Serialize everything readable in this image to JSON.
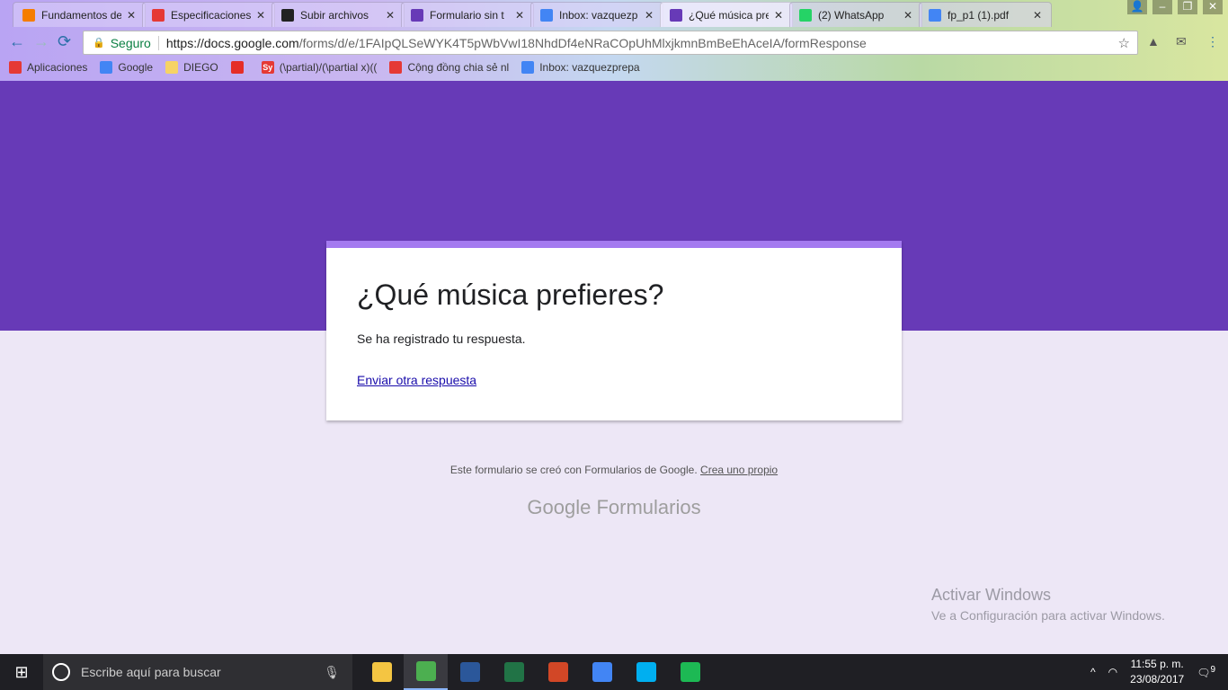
{
  "browser": {
    "tabs": [
      {
        "title": "Fundamentos de",
        "icon": "blogger-icon",
        "color": "#f57d00"
      },
      {
        "title": "Especificaciones",
        "icon": "pdf-icon",
        "color": "#e53935"
      },
      {
        "title": "Subir archivos",
        "icon": "github-icon",
        "color": "#222222"
      },
      {
        "title": "Formulario sin t",
        "icon": "forms-icon",
        "color": "#673ab7"
      },
      {
        "title": "Inbox: vazquezp",
        "icon": "inbox-icon",
        "color": "#4285f4"
      },
      {
        "title": "¿Qué música pre",
        "icon": "forms-icon",
        "color": "#673ab7",
        "active": true
      },
      {
        "title": "(2) WhatsApp",
        "icon": "whatsapp-icon",
        "color": "#25d366"
      },
      {
        "title": "fp_p1 (1).pdf",
        "icon": "file-icon",
        "color": "#4285f4"
      }
    ],
    "secure_label": "Seguro",
    "url_host": "https://docs.google.com",
    "url_path": "/forms/d/e/1FAIpQLSeWYK4T5pWbVwI18NhdDf4eNRaCOpUhMlxjkmnBmBeEhAceIA/formResponse",
    "bookmarks": [
      {
        "label": "Aplicaciones",
        "color": "#e53935"
      },
      {
        "label": "Google",
        "color": "#4285f4"
      },
      {
        "label": "DIEGO",
        "color": "#f6d365"
      },
      {
        "label": "",
        "color": "#e52d27"
      },
      {
        "label": "(\\partial)/(\\partial x)((",
        "color": "#e53935",
        "icon_text": "Sy"
      },
      {
        "label": "Cộng đồng chia sẻ nl",
        "color": "#e53935"
      },
      {
        "label": "Inbox: vazquezprepa",
        "color": "#4285f4"
      }
    ]
  },
  "form": {
    "title": "¿Qué música prefieres?",
    "confirmation": "Se ha registrado tu respuesta.",
    "another_link": "Enviar otra respuesta",
    "footer_text": "Este formulario se creó con Formularios de Google.",
    "footer_link": "Crea uno propio",
    "brand": "Google Formularios",
    "accent": "#673ab7"
  },
  "watermark": {
    "line1": "Activar Windows",
    "line2": "Ve a Configuración para activar Windows."
  },
  "taskbar": {
    "search_placeholder": "Escribe aquí para buscar",
    "apps": [
      {
        "name": "file-explorer",
        "color": "#f4c542"
      },
      {
        "name": "chrome",
        "color": "#4caf50",
        "active": true
      },
      {
        "name": "word",
        "color": "#2b579a"
      },
      {
        "name": "excel",
        "color": "#217346"
      },
      {
        "name": "powerpoint",
        "color": "#d24726"
      },
      {
        "name": "docs",
        "color": "#4285f4"
      },
      {
        "name": "skype",
        "color": "#00aff0"
      },
      {
        "name": "spotify",
        "color": "#1db954"
      }
    ],
    "time": "11:55 p. m.",
    "date": "23/08/2017",
    "notifications": "9"
  }
}
